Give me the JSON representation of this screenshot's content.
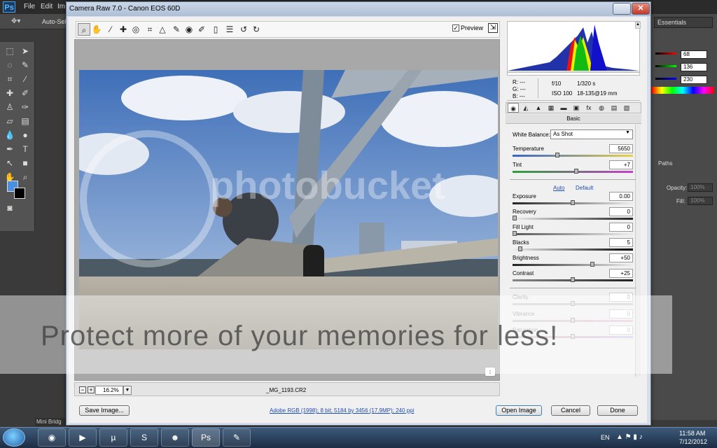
{
  "photoshop": {
    "logo": "Ps",
    "menus": [
      "File",
      "Edit",
      "Im"
    ],
    "options_label": "Auto-Selec",
    "workspace": "Essentials",
    "rgb_values": [
      "68",
      "136",
      "230"
    ],
    "opacity_label": "Opacity:",
    "opacity_value": "100%",
    "fill_label": "Fill:",
    "fill_value": "100%",
    "paths_tab": "Paths",
    "bridge_tab": "Mini Bridg"
  },
  "dialog": {
    "title": "Camera Raw 7.0  -  Canon EOS 60D",
    "preview_label": "Preview",
    "preview_checked": "✓",
    "filename": "_MG_1193.CR2",
    "zoom": "16.2%",
    "zoom_out": "−",
    "zoom_in": "+",
    "workflow_link": "Adobe RGB (1998); 8 bit; 5184 by 3456 (17.9MP); 240 ppi"
  },
  "readout": {
    "r": "R:   ---",
    "g": "G:   ---",
    "b": "B:   ---",
    "aperture": "f/10",
    "shutter": "1/320 s",
    "iso": "ISO 100",
    "lens": "18-135@19 mm"
  },
  "panel": {
    "title": "Basic",
    "white_balance_label": "White Balance:",
    "white_balance_value": "As Shot",
    "auto_label": "Auto",
    "default_label": "Default",
    "adjustments": [
      {
        "label": "Temperature",
        "value": "5650",
        "level": 0.37
      },
      {
        "label": "Tint",
        "value": "+7",
        "level": 0.53
      },
      {
        "label": "Exposure",
        "value": "0.00",
        "level": 0.5
      },
      {
        "label": "Recovery",
        "value": "0",
        "level": 0.0
      },
      {
        "label": "Fill Light",
        "value": "0",
        "level": 0.0
      },
      {
        "label": "Blacks",
        "value": "5",
        "level": 0.05
      },
      {
        "label": "Brightness",
        "value": "+50",
        "level": 0.67
      },
      {
        "label": "Contrast",
        "value": "+25",
        "level": 0.5
      },
      {
        "label": "Clarity",
        "value": "0",
        "level": 0.5
      },
      {
        "label": "Vibrance",
        "value": "0",
        "level": 0.5
      },
      {
        "label": "Saturation",
        "value": "0",
        "level": 0.5
      }
    ]
  },
  "buttons": {
    "save": "Save Image...",
    "open": "Open Image",
    "cancel": "Cancel",
    "done": "Done"
  },
  "watermark": {
    "band_text": "Protect more of your memories for less!",
    "brand": "photobucket"
  },
  "taskbar": {
    "language": "EN",
    "time": "11:58 AM",
    "date": "7/12/2012"
  }
}
